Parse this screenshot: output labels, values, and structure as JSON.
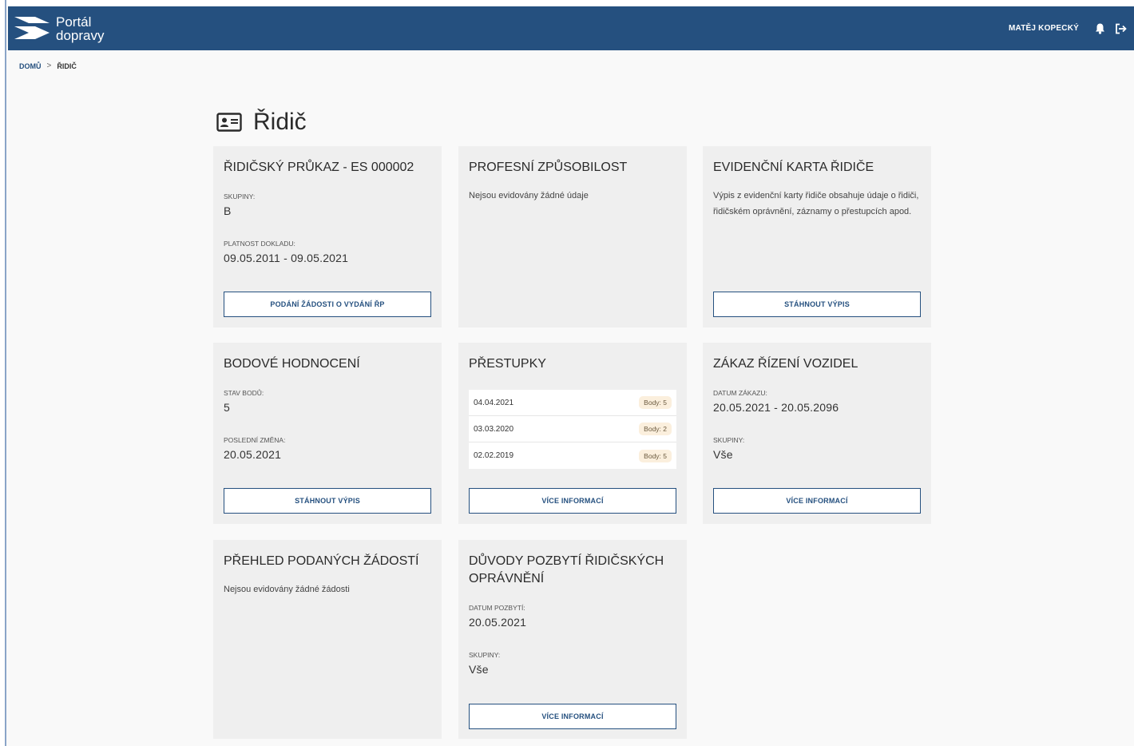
{
  "header": {
    "logo_line1": "Portál",
    "logo_line2": "dopravy",
    "user_name": "MATĚJ KOPECKÝ",
    "icons": [
      "bell-icon",
      "logout-icon"
    ]
  },
  "breadcrumb": {
    "home": "DOMŮ",
    "separator": ">",
    "current": "ŘIDIČ"
  },
  "page": {
    "title": "Řidič",
    "title_icon": "id-card-icon"
  },
  "cards": {
    "licence": {
      "title": "ŘIDIČSKÝ PRŮKAZ - ES 000002",
      "groups_label": "SKUPINY:",
      "groups_value": "B",
      "validity_label": "PLATNOST DOKLADU:",
      "validity_value": "09.05.2011 - 09.05.2021",
      "button": "PODÁNÍ ŽÁDOSTI O VYDÁNÍ ŘP"
    },
    "competence": {
      "title": "PROFESNÍ ZPŮSOBILOST",
      "text": "Nejsou evidovány žádné údaje"
    },
    "record_card": {
      "title": "EVIDENČNÍ KARTA ŘIDIČE",
      "text": "Výpis z evidenční karty řidiče obsahuje údaje o řidiči, řidičském oprávnění, záznamy o přestupcích apod.",
      "button": "STÁHNOUT VÝPIS"
    },
    "points": {
      "title": "BODOVÉ HODNOCENÍ",
      "state_label": "STAV BODŮ:",
      "state_value": "5",
      "change_label": "POSLEDNÍ ZMĚNA:",
      "change_value": "20.05.2021",
      "button": "STÁHNOUT VÝPIS"
    },
    "offenses": {
      "title": "PŘESTUPKY",
      "rows": [
        {
          "date": "04.04.2021",
          "points": "Body: 5"
        },
        {
          "date": "03.03.2020",
          "points": "Body: 2"
        },
        {
          "date": "02.02.2019",
          "points": "Body: 5"
        }
      ],
      "button": "VÍCE INFORMACÍ"
    },
    "ban": {
      "title": "ZÁKAZ ŘÍZENÍ VOZIDEL",
      "date_label": "DATUM ZÁKAZU:",
      "date_value": "20.05.2021 - 20.05.2096",
      "groups_label": "SKUPINY:",
      "groups_value": "Vše",
      "button": "VÍCE INFORMACÍ"
    },
    "applications": {
      "title": "PŘEHLED PODANÝCH ŽÁDOSTÍ",
      "text": "Nejsou evidovány žádné žádosti"
    },
    "revocation": {
      "title": "DŮVODY POZBYTÍ ŘIDIČSKÝCH OPRÁVNĚNÍ",
      "date_label": "DATUM POZBYTÍ:",
      "date_value": "20.05.2021",
      "groups_label": "SKUPINY:",
      "groups_value": "Vše",
      "button": "VÍCE INFORMACÍ"
    }
  },
  "colors": {
    "header": "#25507f",
    "card": "#efefef",
    "badge": "#fbefdd"
  }
}
